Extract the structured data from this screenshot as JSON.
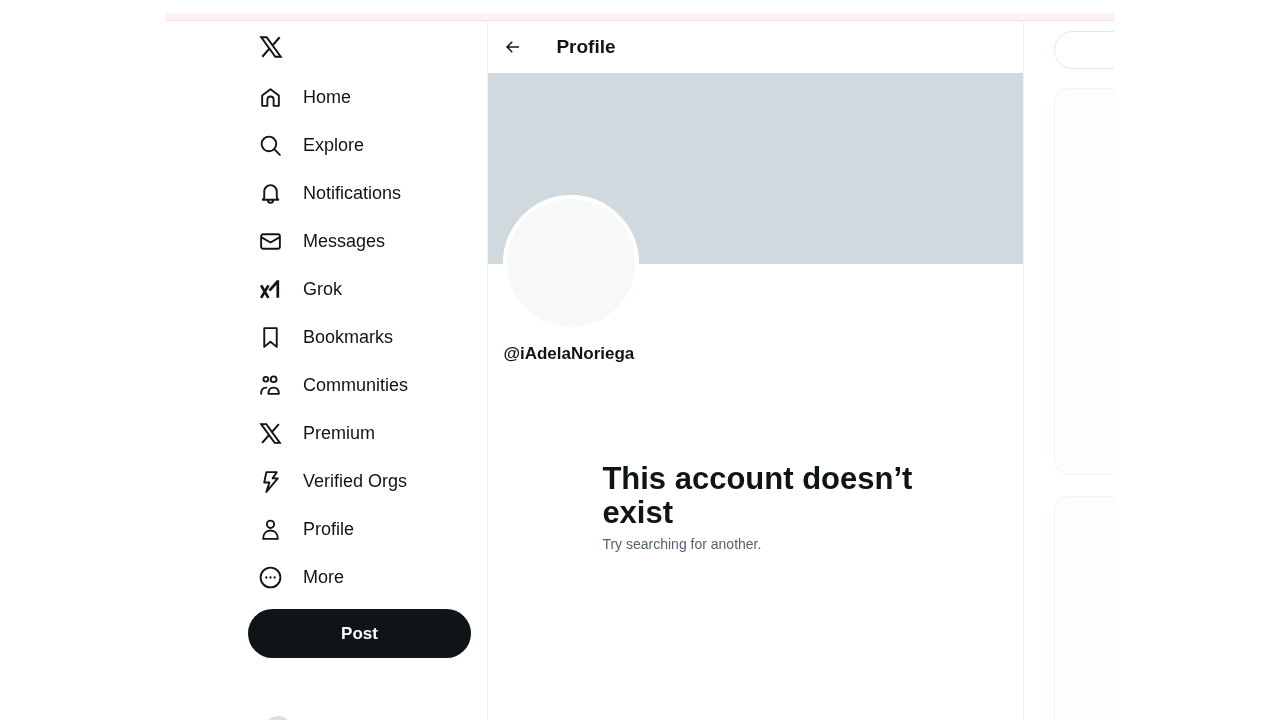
{
  "sidebar": {
    "items": [
      {
        "label": "Home"
      },
      {
        "label": "Explore"
      },
      {
        "label": "Notifications"
      },
      {
        "label": "Messages"
      },
      {
        "label": "Grok"
      },
      {
        "label": "Bookmarks"
      },
      {
        "label": "Communities"
      },
      {
        "label": "Premium"
      },
      {
        "label": "Verified Orgs"
      },
      {
        "label": "Profile"
      },
      {
        "label": "More"
      }
    ],
    "post_button": "Post"
  },
  "header": {
    "title": "Profile"
  },
  "profile": {
    "handle": "@iAdelaNoriega"
  },
  "empty_state": {
    "title": "This account doesn’t exist",
    "subtitle": "Try searching for another."
  }
}
